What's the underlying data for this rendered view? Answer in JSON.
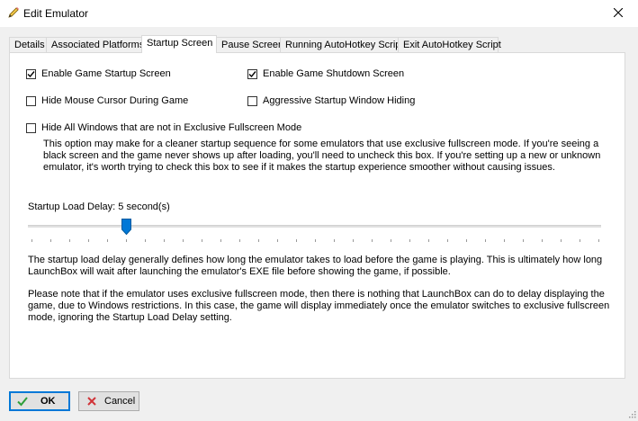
{
  "window": {
    "title": "Edit Emulator"
  },
  "tabs": [
    {
      "label": "Details"
    },
    {
      "label": "Associated Platforms"
    },
    {
      "label": "Startup Screen"
    },
    {
      "label": "Pause Screen"
    },
    {
      "label": "Running AutoHotkey Script"
    },
    {
      "label": "Exit AutoHotkey Script"
    }
  ],
  "options": {
    "enable_startup": {
      "label": "Enable Game Startup Screen",
      "checked": true
    },
    "enable_shutdown": {
      "label": "Enable Game Shutdown Screen",
      "checked": true
    },
    "hide_cursor": {
      "label": "Hide Mouse Cursor During Game",
      "checked": false
    },
    "aggressive_hiding": {
      "label": "Aggressive Startup Window Hiding",
      "checked": false
    },
    "hide_windows": {
      "label": "Hide All Windows that are not in Exclusive Fullscreen Mode",
      "checked": false
    }
  },
  "hide_windows_description": "This option may make for a cleaner startup sequence for some emulators that use exclusive fullscreen mode. If you're seeing a black screen and the game never shows up after loading, you'll need to uncheck this box. If you're setting up a new or unknown emulator, it's worth trying to check this box to see if it makes the startup experience smoother without causing issues.",
  "load_delay": {
    "label": "Startup Load Delay: 5 second(s)",
    "value": 5,
    "max": 30
  },
  "load_delay_description_1": "The startup load delay generally defines how long the emulator takes to load before the game is playing. This is ultimately how long LaunchBox will wait after launching the emulator's EXE file before showing the game, if possible.",
  "load_delay_description_2": "Please note that if the emulator uses exclusive fullscreen mode, then there is nothing that LaunchBox can do to delay displaying the game, due to Windows restrictions. In this case, the game will display immediately once the emulator switches to exclusive fullscreen mode, ignoring the Startup Load Delay setting.",
  "buttons": {
    "ok": "OK",
    "cancel": "Cancel"
  },
  "colors": {
    "accent": "#0078d7",
    "ok_check": "#2e9e3a",
    "cancel_x": "#d13438"
  }
}
